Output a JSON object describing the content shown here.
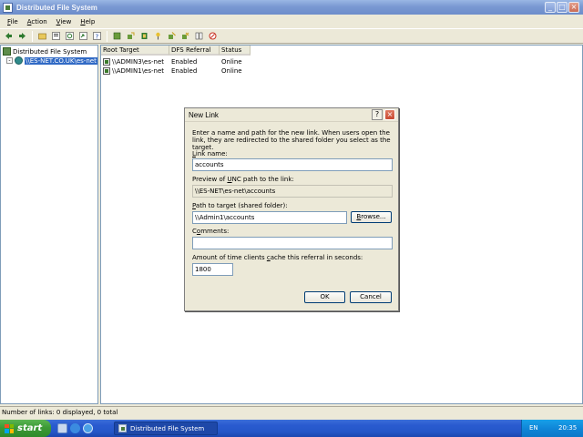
{
  "window": {
    "title": "Distributed File System"
  },
  "menu": [
    {
      "pre": "",
      "u": "F",
      "post": "ile"
    },
    {
      "pre": "",
      "u": "A",
      "post": "ction"
    },
    {
      "pre": "",
      "u": "V",
      "post": "iew"
    },
    {
      "pre": "",
      "u": "H",
      "post": "elp"
    }
  ],
  "toolbar": {
    "icons": [
      "back-icon",
      "forward-icon",
      "up-folder-icon",
      "properties-icon",
      "refresh-icon",
      "export-list-icon",
      "help-icon",
      "new-root-icon",
      "new-link-icon",
      "delete-icon",
      "new-target-icon",
      "check-status-icon",
      "filter-icon",
      "replicate-icon",
      "cancel-icon"
    ]
  },
  "tree": {
    "root_label": "Distributed File System",
    "child_label": "\\\\ES-NET.CO.UK\\es-net"
  },
  "list": {
    "columns": [
      "Root Target",
      "DFS Referral",
      "Status"
    ],
    "rows": [
      {
        "target": "\\\\ADMIN3\\es-net",
        "referral": "Enabled",
        "status": "Online"
      },
      {
        "target": "\\\\ADMIN1\\es-net",
        "referral": "Enabled",
        "status": "Online"
      }
    ]
  },
  "status_bar": {
    "text": "Number of links: 0 displayed, 0 total"
  },
  "dialog": {
    "title": "New Link",
    "intro": "Enter a name and path for the new link. When users open the link, they are redirected to the shared folder you select as the target.",
    "link_name_label": {
      "pre": "",
      "u": "L",
      "post": "ink name:"
    },
    "link_name_value": "accounts",
    "preview_label": {
      "pre": "Preview of ",
      "u": "U",
      "post": "NC path to the link:"
    },
    "preview_value": "\\\\ES-NET\\es-net\\accounts",
    "target_label": {
      "pre": "",
      "u": "P",
      "post": "ath to target (shared folder):"
    },
    "target_value": "\\\\Admin1\\accounts",
    "browse": {
      "pre": "",
      "u": "B",
      "post": "rowse..."
    },
    "comments_label": {
      "pre": "C",
      "u": "o",
      "post": "mments:"
    },
    "comments_value": "",
    "cache_label": {
      "pre": "Amount of time clients ",
      "u": "c",
      "post": "ache this referral in seconds:"
    },
    "cache_value": "1800",
    "ok": "OK",
    "cancel": "Cancel"
  },
  "taskbar": {
    "start": "start",
    "task_label": "Distributed File System",
    "language": "EN",
    "clock": "20:35"
  },
  "colors": {
    "selection": "#316ac5",
    "taskbar": "#2457c8",
    "start": "#3c9a36"
  }
}
